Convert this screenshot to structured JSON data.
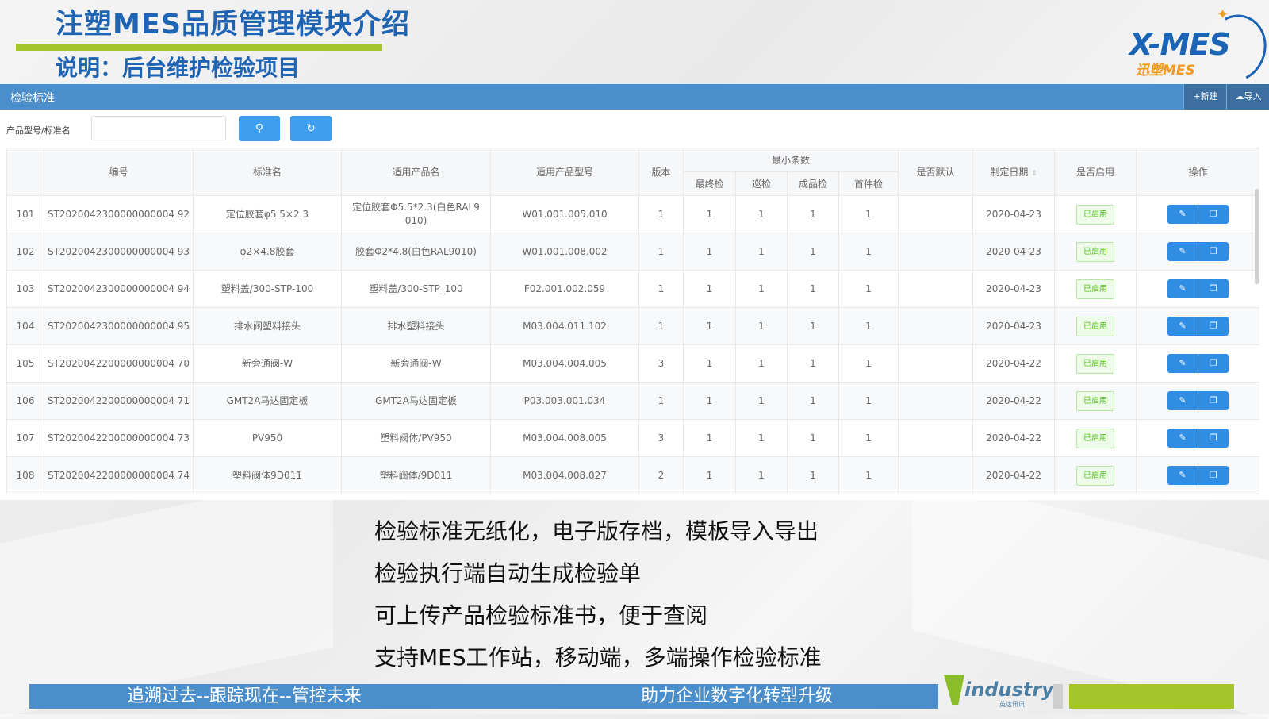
{
  "slide": {
    "title": "注塑MES品质管理模块介绍",
    "subtitle": "说明：后台维护检验项目",
    "logo_main": "X-MES",
    "logo_sub": "迅塑MES",
    "bullets": [
      "检验标准无纸化，电子版存档，模板导入导出",
      "检验执行端自动生成检验单",
      "可上传产品检验标准书，便于查阅",
      "支持MES工作站，移动端，多端操作检验标准"
    ],
    "footer_left": "追溯过去--跟踪现在--管控未来",
    "footer_right": "助力企业数字化转型升级",
    "industry_logo": "industry",
    "industry_logo_sub": "英达讯讯"
  },
  "app": {
    "panel_title": "检验标准",
    "new_button": "+新建",
    "import_button": "导入",
    "search_label": "产品型号/标准名",
    "search_value": "",
    "search_icon": "search-icon",
    "reset_icon": "refresh-icon",
    "headers": {
      "index": "",
      "code": "编号",
      "std_name": "标准名",
      "product_name": "适用产品名",
      "product_model": "适用产品型号",
      "version": "版本",
      "min_sample": "最小条数",
      "final": "最终检",
      "patrol": "巡检",
      "finished": "成品检",
      "first": "首件检",
      "is_default": "是否默认",
      "date": "制定日期",
      "enabled": "是否启用",
      "ops": "操作"
    },
    "rows": [
      {
        "index": "101",
        "code": "ST2020042300000000004 92",
        "std_name": "定位胶套φ5.5×2.3",
        "product_name": "定位胶套Φ5.5*2.3(白色RAL9 010)",
        "product_model": "W01.001.005.010",
        "version": "1",
        "final": "1",
        "patrol": "1",
        "finished": "1",
        "first": "1",
        "is_default": "",
        "date": "2020-04-23",
        "enabled": "已启用"
      },
      {
        "index": "102",
        "code": "ST2020042300000000004 93",
        "std_name": "φ2×4.8胶套",
        "product_name": "胶套Φ2*4.8(白色RAL9010)",
        "product_model": "W01.001.008.002",
        "version": "1",
        "final": "1",
        "patrol": "1",
        "finished": "1",
        "first": "1",
        "is_default": "",
        "date": "2020-04-23",
        "enabled": "已启用"
      },
      {
        "index": "103",
        "code": "ST2020042300000000004 94",
        "std_name": "塑料盖/300-STP-100",
        "product_name": "塑料盖/300-STP_100",
        "product_model": "F02.001.002.059",
        "version": "1",
        "final": "1",
        "patrol": "1",
        "finished": "1",
        "first": "1",
        "is_default": "",
        "date": "2020-04-23",
        "enabled": "已启用"
      },
      {
        "index": "104",
        "code": "ST2020042300000000004 95",
        "std_name": "排水阀塑料接头",
        "product_name": "排水塑料接头",
        "product_model": "M03.004.011.102",
        "version": "1",
        "final": "1",
        "patrol": "1",
        "finished": "1",
        "first": "1",
        "is_default": "",
        "date": "2020-04-23",
        "enabled": "已启用"
      },
      {
        "index": "105",
        "code": "ST2020042200000000004 70",
        "std_name": "新旁通阀-W",
        "product_name": "新旁通阀-W",
        "product_model": "M03.004.004.005",
        "version": "3",
        "final": "1",
        "patrol": "1",
        "finished": "1",
        "first": "1",
        "is_default": "",
        "date": "2020-04-22",
        "enabled": "已启用"
      },
      {
        "index": "106",
        "code": "ST2020042200000000004 71",
        "std_name": "GMT2A马达固定板",
        "product_name": "GMT2A马达固定板",
        "product_model": "P03.003.001.034",
        "version": "1",
        "final": "1",
        "patrol": "1",
        "finished": "1",
        "first": "1",
        "is_default": "",
        "date": "2020-04-22",
        "enabled": "已启用"
      },
      {
        "index": "107",
        "code": "ST2020042200000000004 73",
        "std_name": "PV950",
        "product_name": "塑料阀体/PV950",
        "product_model": "M03.004.008.005",
        "version": "3",
        "final": "1",
        "patrol": "1",
        "finished": "1",
        "first": "1",
        "is_default": "",
        "date": "2020-04-22",
        "enabled": "已启用"
      },
      {
        "index": "108",
        "code": "ST2020042200000000004 74",
        "std_name": "塑料阀体9D011",
        "product_name": "塑料阀体/9D011",
        "product_model": "M03.004.008.027",
        "version": "2",
        "final": "1",
        "patrol": "1",
        "finished": "1",
        "first": "1",
        "is_default": "",
        "date": "2020-04-22",
        "enabled": "已启用"
      }
    ],
    "edit_icon": "edit-icon",
    "copy_icon": "copy-icon",
    "sort_icon": "sort-icon",
    "colors": {
      "header_blue": "#4a8ecb",
      "button_blue": "#3e9ef0",
      "title_blue": "#1f64b3",
      "accent_green": "#a6c52b",
      "enabled_green": "#52c41a"
    }
  }
}
